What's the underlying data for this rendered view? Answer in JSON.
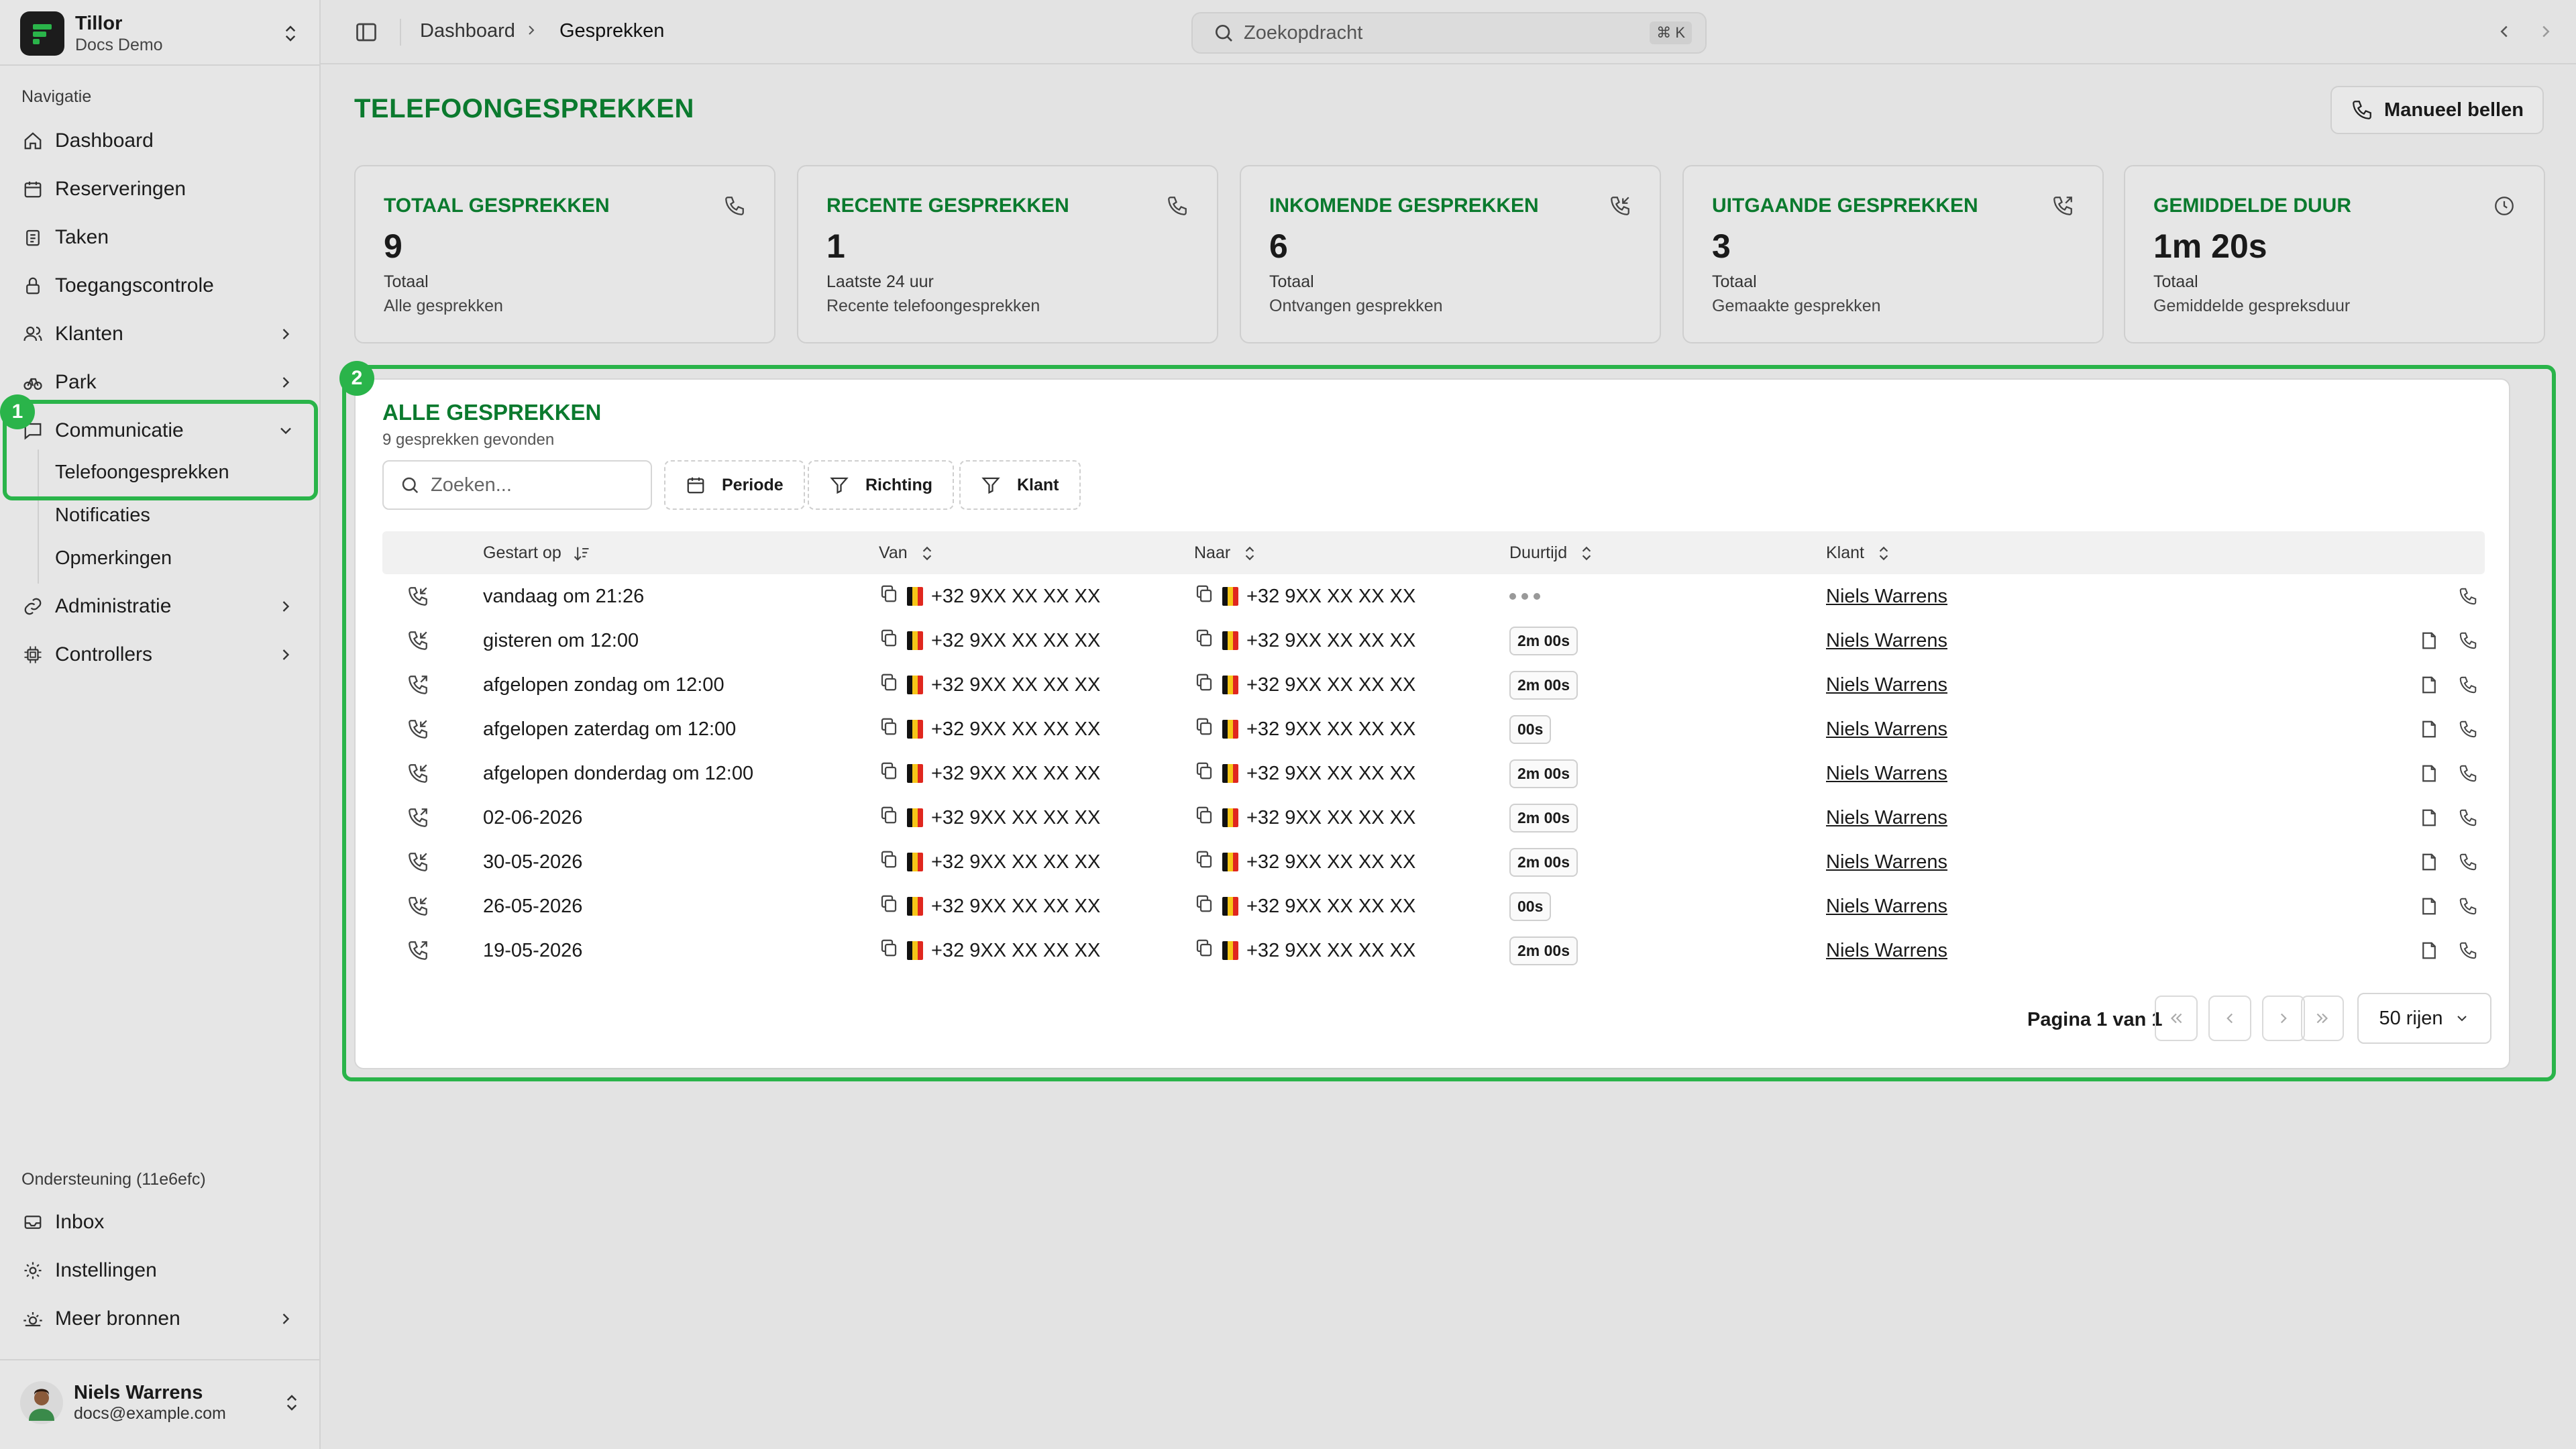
{
  "app": {
    "name": "Tillor",
    "workspace": "Docs Demo"
  },
  "sidebar": {
    "nav_label": "Navigatie",
    "items": [
      {
        "label": "Dashboard",
        "icon": "home-icon"
      },
      {
        "label": "Reserveringen",
        "icon": "calendar-icon"
      },
      {
        "label": "Taken",
        "icon": "clipboard-icon"
      },
      {
        "label": "Toegangscontrole",
        "icon": "lock-icon"
      },
      {
        "label": "Klanten",
        "icon": "users-icon"
      },
      {
        "label": "Park",
        "icon": "bike-icon"
      },
      {
        "label": "Communicatie",
        "icon": "message-icon"
      },
      {
        "label": "Administratie",
        "icon": "link-icon"
      },
      {
        "label": "Controllers",
        "icon": "chip-icon"
      }
    ],
    "sub_items": [
      "Telefoongesprekken",
      "Notificaties",
      "Opmerkingen"
    ],
    "support_label": "Ondersteuning (11e6efc)",
    "support_items": [
      {
        "label": "Inbox",
        "icon": "inbox-icon"
      },
      {
        "label": "Instellingen",
        "icon": "gear-icon"
      },
      {
        "label": "Meer bronnen",
        "icon": "sun-icon"
      }
    ],
    "user": {
      "name": "Niels Warrens",
      "email": "docs@example.com"
    }
  },
  "topbar": {
    "breadcrumb": [
      "Dashboard",
      "Gesprekken"
    ],
    "search_placeholder": "Zoekopdracht",
    "shortcut": "⌘ K"
  },
  "page": {
    "title": "TELEFOONGESPREKKEN",
    "manual_call_button": "Manueel bellen"
  },
  "stats": [
    {
      "title": "TOTAAL GESPREKKEN",
      "value": "9",
      "sub": "Totaal",
      "desc": "Alle gesprekken",
      "icon": "phone-icon"
    },
    {
      "title": "RECENTE GESPREKKEN",
      "value": "1",
      "sub": "Laatste 24 uur",
      "desc": "Recente telefoongesprekken",
      "icon": "phone-icon"
    },
    {
      "title": "INKOMENDE GESPREKKEN",
      "value": "6",
      "sub": "Totaal",
      "desc": "Ontvangen gesprekken",
      "icon": "phone-incoming-icon"
    },
    {
      "title": "UITGAANDE GESPREKKEN",
      "value": "3",
      "sub": "Totaal",
      "desc": "Gemaakte gesprekken",
      "icon": "phone-outgoing-icon"
    },
    {
      "title": "GEMIDDELDE DUUR",
      "value": "1m 20s",
      "sub": "Totaal",
      "desc": "Gemiddelde gespreksduur",
      "icon": "clock-icon"
    }
  ],
  "table": {
    "title": "ALLE GESPREKKEN",
    "subtitle": "9 gesprekken gevonden",
    "search_placeholder": "Zoeken...",
    "filters": [
      "Periode",
      "Richting",
      "Klant"
    ],
    "columns": [
      "Gestart op",
      "Van",
      "Naar",
      "Duurtijd",
      "Klant"
    ],
    "rows": [
      {
        "direction": "incoming",
        "started": "vandaag om 21:26",
        "from": "+32 9XX XX XX XX",
        "to": "+32 9XX XX XX XX",
        "duration": "",
        "customer": "Niels Warrens",
        "has_note": false
      },
      {
        "direction": "incoming",
        "started": "gisteren om 12:00",
        "from": "+32 9XX XX XX XX",
        "to": "+32 9XX XX XX XX",
        "duration": "2m 00s",
        "customer": "Niels Warrens",
        "has_note": true
      },
      {
        "direction": "outgoing",
        "started": "afgelopen zondag om 12:00",
        "from": "+32 9XX XX XX XX",
        "to": "+32 9XX XX XX XX",
        "duration": "2m 00s",
        "customer": "Niels Warrens",
        "has_note": true
      },
      {
        "direction": "incoming",
        "started": "afgelopen zaterdag om 12:00",
        "from": "+32 9XX XX XX XX",
        "to": "+32 9XX XX XX XX",
        "duration": "00s",
        "customer": "Niels Warrens",
        "has_note": true
      },
      {
        "direction": "incoming",
        "started": "afgelopen donderdag om 12:00",
        "from": "+32 9XX XX XX XX",
        "to": "+32 9XX XX XX XX",
        "duration": "2m 00s",
        "customer": "Niels Warrens",
        "has_note": true
      },
      {
        "direction": "outgoing",
        "started": "02-06-2026",
        "from": "+32 9XX XX XX XX",
        "to": "+32 9XX XX XX XX",
        "duration": "2m 00s",
        "customer": "Niels Warrens",
        "has_note": true
      },
      {
        "direction": "incoming",
        "started": "30-05-2026",
        "from": "+32 9XX XX XX XX",
        "to": "+32 9XX XX XX XX",
        "duration": "2m 00s",
        "customer": "Niels Warrens",
        "has_note": true
      },
      {
        "direction": "incoming",
        "started": "26-05-2026",
        "from": "+32 9XX XX XX XX",
        "to": "+32 9XX XX XX XX",
        "duration": "00s",
        "customer": "Niels Warrens",
        "has_note": true
      },
      {
        "direction": "outgoing",
        "started": "19-05-2026",
        "from": "+32 9XX XX XX XX",
        "to": "+32 9XX XX XX XX",
        "duration": "2m 00s",
        "customer": "Niels Warrens",
        "has_note": true
      }
    ],
    "pagination": {
      "label": "Pagina 1 van 1",
      "rows_per_page": "50 rijen"
    }
  },
  "annotations": [
    "1",
    "2"
  ],
  "colors": {
    "accent": "#0b7a2e",
    "highlight": "#2ab44a"
  }
}
